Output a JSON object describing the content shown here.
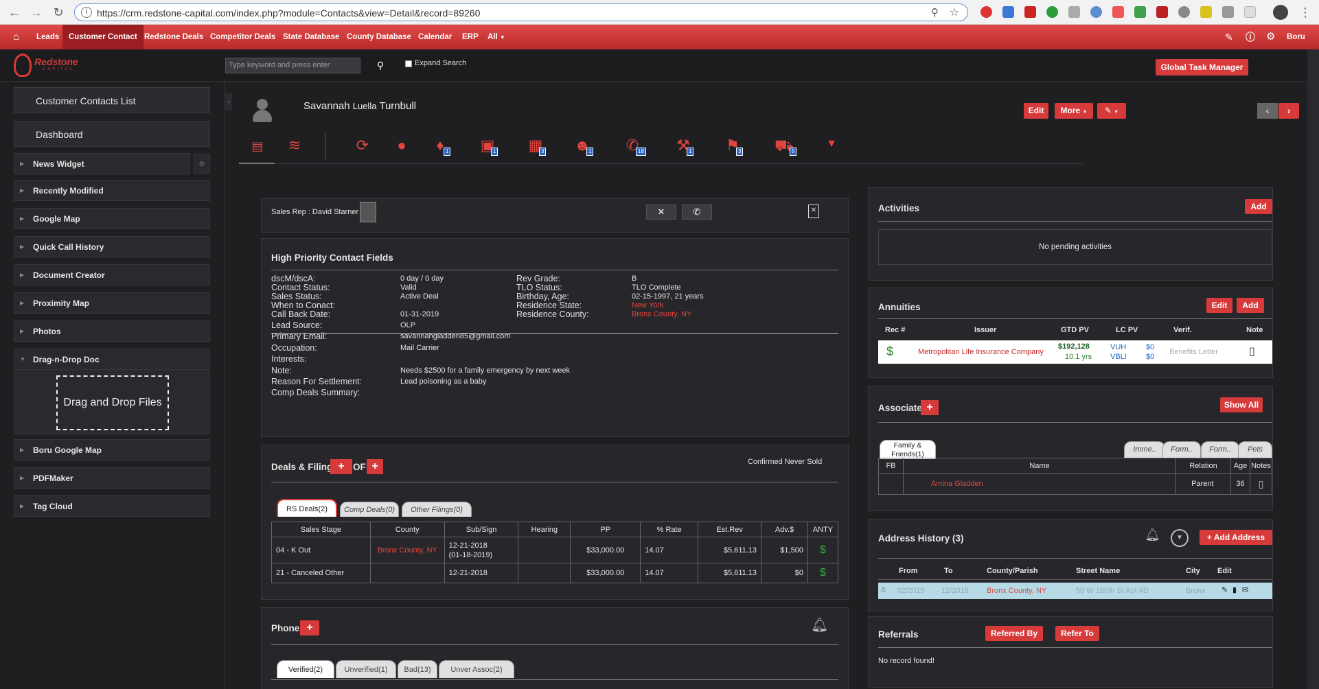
{
  "browser": {
    "url": "https://crm.redstone-capital.com/index.php?module=Contacts&view=Detail&record=89260"
  },
  "nav": {
    "items": [
      "Leads",
      "Customer Contact",
      "Redstone Deals",
      "Competitor Deals",
      "State Database",
      "County Database",
      "Calendar",
      "ERP",
      "All"
    ],
    "user": "Boru"
  },
  "header": {
    "logo": "Redstone",
    "logo_sub": "CAPITAL",
    "search_placeholder": "Type keyword and press enter",
    "expand_search": "Expand Search",
    "global_task": "Global Task Manager"
  },
  "sidebar": {
    "big": [
      "Customer Contacts List",
      "Dashboard"
    ],
    "items": [
      "News Widget",
      "Recently Modified",
      "Google Map",
      "Quick Call History",
      "Document Creator",
      "Proximity Map",
      "Photos",
      "Drag-n-Drop Doc"
    ],
    "drop_label": "Drag and Drop Files",
    "items2": [
      "Boru Google Map",
      "PDFMaker",
      "Tag Cloud"
    ]
  },
  "contact": {
    "first": "Savannah",
    "middle": "Luella",
    "last": "Turnbull",
    "edit": "Edit",
    "more": "More"
  },
  "icon_badges": {
    "money": "1",
    "calendar": "1",
    "docs": "3",
    "people": "1",
    "phone": "18",
    "gavel": "1",
    "map": "3",
    "truck": "5"
  },
  "sales_rep": "Sales Rep : David Starner",
  "high_priority": {
    "title": "High Priority Contact Fields",
    "left": [
      {
        "label": "dscM/dscA:",
        "value": "0 day / 0 day"
      },
      {
        "label": "Contact Status:",
        "value": "Valid"
      },
      {
        "label": "Sales Status:",
        "value": "Active Deal"
      },
      {
        "label": "When to Conact:",
        "value": ""
      },
      {
        "label": "Call Back Date:",
        "value": "01-31-2019"
      }
    ],
    "right": [
      {
        "label": "Rev Grade:",
        "value": "B"
      },
      {
        "label": "TLO Status:",
        "value": "TLO Complete"
      },
      {
        "label": "Birthday, Age:",
        "value": "02-15-1997, 21 years"
      },
      {
        "label": "Residence State:",
        "value": "New York"
      },
      {
        "label": "Residence County:",
        "value": "Bronx County, NY"
      }
    ],
    "lower": [
      {
        "label": "Lead Source:",
        "value": "OLP"
      },
      {
        "label": "Primary Email:",
        "value": "savannahgladden85@gmail.com"
      },
      {
        "label": "Occupation:",
        "value": "Mail Carrier"
      },
      {
        "label": "Interests:",
        "value": ""
      },
      {
        "label": "Note:",
        "value": "Needs $2500 for a family emergency by next week"
      },
      {
        "label": "Reason For Settlement:",
        "value": "Lead poisoning as a baby"
      },
      {
        "label": "Comp Deals Summary:",
        "value": ""
      }
    ]
  },
  "deals": {
    "title": "Deals & Filings",
    "of": "OF",
    "confirmed": "Confirmed Never Sold",
    "tabs": [
      "RS Deals(2)",
      "Comp Deals(0)",
      "Other Filings(0)"
    ],
    "headers": [
      "Sales Stage",
      "County",
      "Sub/Sign",
      "Hearing",
      "PP",
      "% Rate",
      "Est.Rev",
      "Adv.$",
      "ANTY"
    ],
    "rows": [
      {
        "stage": "04 - K Out",
        "county": "Bronx County, NY",
        "sub": "12-21-2018",
        "sub2": "(01-18-2019)",
        "hearing": "",
        "pp": "$33,000.00",
        "rate": "14.07",
        "rev": "$5,611.13",
        "adv": "$1,500"
      },
      {
        "stage": "21 - Canceled Other",
        "county": "",
        "sub": "12-21-2018",
        "sub2": "",
        "hearing": "",
        "pp": "$33,000.00",
        "rate": "14.07",
        "rev": "$5,611.13",
        "adv": "$0"
      }
    ]
  },
  "phones": {
    "title": "Phones",
    "tabs": [
      "Verified(2)",
      "Unverified(1)",
      "Bad(13)",
      "Unver Assoc(2)"
    ]
  },
  "activities": {
    "title": "Activities",
    "add": "Add",
    "empty": "No pending activities"
  },
  "annuities": {
    "title": "Annuities",
    "edit": "Edit",
    "add": "Add",
    "headers": [
      "Rec #",
      "Issuer",
      "GTD PV",
      "LC PV",
      "Verif.",
      "Note"
    ],
    "row": {
      "issuer": "Metropolitan Life Insurance Company",
      "gtd": "$192,128",
      "gtd_yrs": "10.1 yrs",
      "lc1": "VUH",
      "lc1v": "$0",
      "lc2": "VBLI",
      "lc2v": "$0",
      "verif": "Benefits Letter"
    }
  },
  "associates": {
    "title": "Associates",
    "show_all": "Show All",
    "tabs": [
      "Family & Friends(1)",
      "Imme..",
      "Form..",
      "Form..",
      "Pets"
    ],
    "headers": [
      "FB",
      "Name",
      "Relation",
      "Age",
      "Notes"
    ],
    "row": {
      "name": "Amina Gladden",
      "relation": "Parent",
      "age": "36"
    }
  },
  "address": {
    "title": "Address History (3)",
    "add": "Add Address",
    "headers": [
      "From",
      "To",
      "County/Parish",
      "Street Name",
      "City",
      "Edit"
    ],
    "row": {
      "from": "02/2015",
      "to": "12/2018",
      "county": "Bronx County, NY",
      "street": "50 W 180th St Apt 4D",
      "city": "Bronx"
    }
  },
  "referrals": {
    "title": "Referrals",
    "by": "Referred By",
    "to": "Refer To",
    "empty": "No record found!"
  }
}
